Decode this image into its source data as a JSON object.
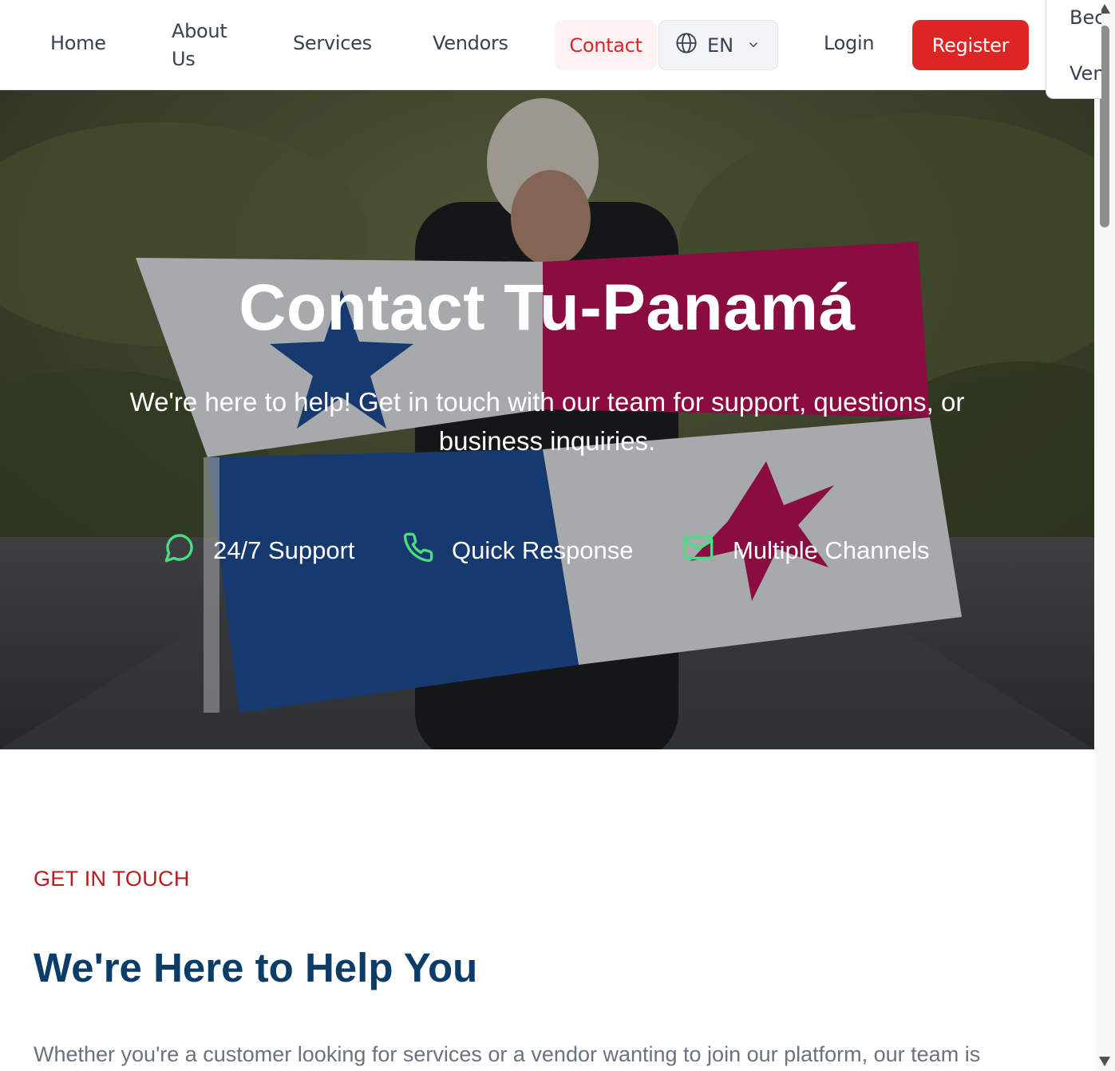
{
  "nav": {
    "home": "Home",
    "about": "About Us",
    "services": "Services",
    "vendors": "Vendors",
    "contact": "Contact",
    "language": "EN",
    "login": "Login",
    "register": "Register"
  },
  "side_panel": {
    "line1": "Become",
    "line2": "Vendor"
  },
  "hero": {
    "title": "Contact Tu-Panamá",
    "subtitle": "We're here to help! Get in touch with our team for support, questions, or business inquiries.",
    "features": [
      {
        "icon": "chat-bubble-icon",
        "label": "24/7 Support"
      },
      {
        "icon": "phone-icon",
        "label": "Quick Response"
      },
      {
        "icon": "mail-icon",
        "label": "Multiple Channels"
      }
    ]
  },
  "section": {
    "eyebrow": "GET IN TOUCH",
    "title": "We're Here to Help You",
    "text": "Whether you're a customer looking for services or a vendor wanting to join our platform, our team is"
  },
  "colors": {
    "brand_red": "#dc2626",
    "heading_blue": "#0c3d68",
    "feature_green": "#4ade80",
    "eyebrow_red": "#b91c1c"
  }
}
